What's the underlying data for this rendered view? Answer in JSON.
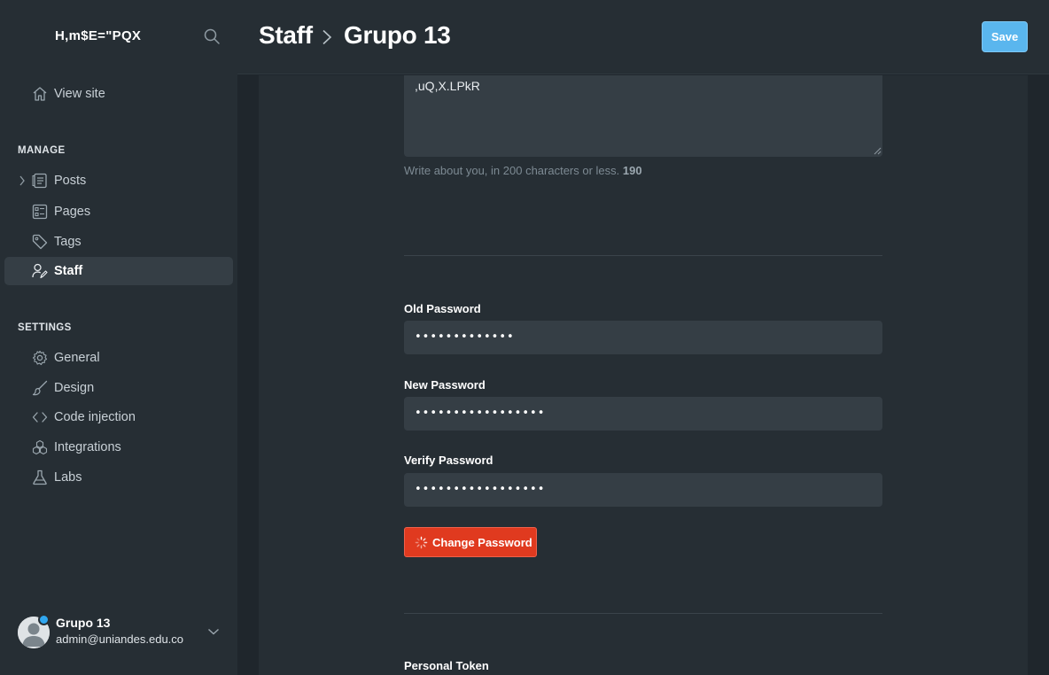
{
  "sidebar": {
    "brand": "H,m$E=\"PQX",
    "view_site": "View site",
    "manage_heading": "MANAGE",
    "manage_items": [
      {
        "label": "Posts",
        "icon": "posts-icon"
      },
      {
        "label": "Pages",
        "icon": "pages-icon"
      },
      {
        "label": "Tags",
        "icon": "tag-icon"
      },
      {
        "label": "Staff",
        "icon": "staff-icon"
      }
    ],
    "settings_heading": "SETTINGS",
    "settings_items": [
      {
        "label": "General",
        "icon": "gear-icon"
      },
      {
        "label": "Design",
        "icon": "brush-icon"
      },
      {
        "label": "Code injection",
        "icon": "code-icon"
      },
      {
        "label": "Integrations",
        "icon": "integrations-icon"
      },
      {
        "label": "Labs",
        "icon": "flask-icon"
      }
    ],
    "user": {
      "name": "Grupo 13",
      "email": "admin@uniandes.edu.co"
    }
  },
  "header": {
    "breadcrumb_parent": "Staff",
    "title": "Grupo 13",
    "save_label": "Save"
  },
  "form": {
    "bio_value": ",uQ,X.LPkR",
    "bio_hint": "Write about you, in 200 characters or less.",
    "bio_remaining": "190",
    "old_password_label": "Old Password",
    "old_password_value": "•••••••••••••",
    "new_password_label": "New Password",
    "new_password_value": "•••••••••••••••••",
    "verify_password_label": "Verify Password",
    "verify_password_value": "•••••••••••••••••",
    "change_password_label": "Change Password",
    "personal_token_label": "Personal Token"
  },
  "colors": {
    "accent_blue": "#5ab6ee",
    "danger_red": "#e03a1f",
    "sidebar_bg": "#262e34",
    "page_bg": "#1f262c"
  }
}
